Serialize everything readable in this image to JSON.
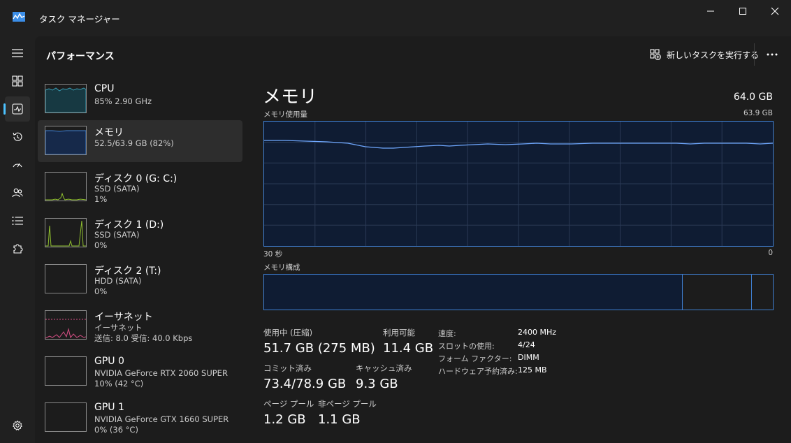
{
  "window": {
    "title": "タスク マネージャー"
  },
  "header": {
    "title": "パフォーマンス",
    "run_task_label": "新しいタスクを実行する"
  },
  "resources": [
    {
      "name": "CPU",
      "line1": "85%  2.90 GHz",
      "line2": ""
    },
    {
      "name": "メモリ",
      "line1": "52.5/63.9 GB (82%)",
      "line2": ""
    },
    {
      "name": "ディスク 0 (G: C:)",
      "line1": "SSD (SATA)",
      "line2": "1%"
    },
    {
      "name": "ディスク 1 (D:)",
      "line1": "SSD (SATA)",
      "line2": "0%"
    },
    {
      "name": "ディスク 2 (T:)",
      "line1": "HDD (SATA)",
      "line2": "0%"
    },
    {
      "name": "イーサネット",
      "line1": "イーサネット",
      "line2": "送信: 8.0  受信: 40.0 Kbps"
    },
    {
      "name": "GPU 0",
      "line1": "NVIDIA GeForce RTX 2060 SUPER",
      "line2": "10%  (42 °C)"
    },
    {
      "name": "GPU 1",
      "line1": "NVIDIA GeForce GTX 1660 SUPER",
      "line2": "0%  (36 °C)"
    }
  ],
  "detail": {
    "title": "メモリ",
    "total": "64.0 GB",
    "usage_label": "メモリ使用量",
    "usage_max": "63.9 GB",
    "time_left": "30 秒",
    "time_right": "0",
    "composition_label": "メモリ構成",
    "usage_percent": 82
  },
  "stats": {
    "in_use_label": "使用中 (圧縮)",
    "in_use_value": "51.7 GB (275 MB)",
    "available_label": "利用可能",
    "available_value": "11.4 GB",
    "committed_label": "コミット済み",
    "committed_value": "73.4/78.9 GB",
    "cached_label": "キャッシュ済み",
    "cached_value": "9.3 GB",
    "paged_label": "ページ プール",
    "paged_value": "1.2 GB",
    "nonpaged_label": "非ページ プール",
    "nonpaged_value": "1.1 GB"
  },
  "info": [
    {
      "key": "速度:",
      "value": "2400 MHz"
    },
    {
      "key": "スロットの使用:",
      "value": "4/24"
    },
    {
      "key": "フォーム ファクター:",
      "value": "DIMM"
    },
    {
      "key": "ハードウェア予約済み:",
      "value": "125 MB"
    }
  ],
  "colors": {
    "accent": "#4cc2ff",
    "memory_line": "#3f7fd1",
    "memory_fill": "#0f1c33",
    "cpu_line": "#3a9fb5",
    "disk_line": "#8fbf2e",
    "net_line": "#d94f86"
  }
}
